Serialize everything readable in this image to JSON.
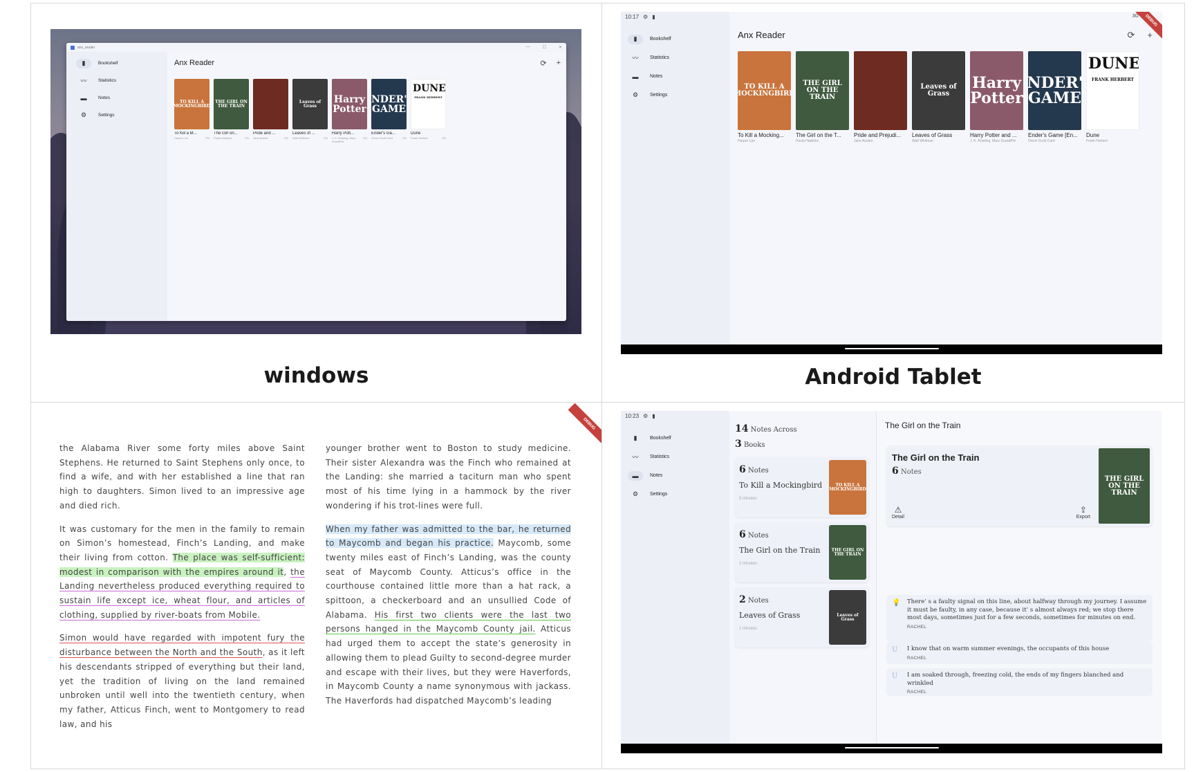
{
  "captions": {
    "windows": "windows",
    "tablet": "Android Tablet"
  },
  "app": {
    "title": "Anx Reader",
    "window_title": "anx_reader",
    "refresh_icon": "sync-icon",
    "add_icon": "plus-icon"
  },
  "nav": [
    {
      "label": "Bookshelf",
      "icon": "book-icon"
    },
    {
      "label": "Statistics",
      "icon": "chart-icon"
    },
    {
      "label": "Notes",
      "icon": "note-icon"
    },
    {
      "label": "Settings",
      "icon": "gear-icon"
    }
  ],
  "books": [
    {
      "short": "To Kill a M...",
      "tablet": "To Kill a Mocking...",
      "author": "Harper Lee",
      "progress": "0%",
      "cover_text": "TO KILL A MOCKINGBIRD",
      "color": "#c9743c"
    },
    {
      "short": "The Girl on...",
      "tablet": "The Girl on the T...",
      "author": "Paula Hawkins",
      "progress": "0%",
      "cover_text": "THE GIRL ON THE TRAIN",
      "color": "#3f5a3e"
    },
    {
      "short": "Pride and ...",
      "tablet": "Pride and Prejudi...",
      "author": "Jane Austen",
      "progress": "0%",
      "cover_text": "",
      "color": "#6e2b22"
    },
    {
      "short": "Leaves of ...",
      "tablet": "Leaves of Grass",
      "author": "Walt Whitman",
      "progress": "0%",
      "cover_text": "Leaves of Grass",
      "color": "#3b3b3b"
    },
    {
      "short": "Harry Pott...",
      "tablet": "Harry Potter and ...",
      "author": "J. K. Rowling, Mary GrandPré",
      "progress": "0%",
      "cover_text": "Harry Potter",
      "color": "#8b5a6a"
    },
    {
      "short": "Ender's Ga...",
      "tablet": "Ender's Game [En...",
      "author": "Orson Scott Card",
      "progress": "0%",
      "cover_text": "ENDER'S GAME",
      "color": "#24384e"
    },
    {
      "short": "Dune",
      "tablet": "Dune",
      "author": "Frank Herbert",
      "progress": "0%",
      "cover_text": "DUNE",
      "sub": "FRANK HERBERT",
      "color": "#ffffff"
    }
  ],
  "tablet_status": {
    "time1": "10:17",
    "time2": "10:23",
    "network": "3G",
    "debug": "DEBUG"
  },
  "reading": {
    "left": [
      {
        "segments": [
          {
            "t": "the Alabama River some forty miles above Saint Stephens. He returned to Saint Stephens only once, to find a wife, and with her established a line that ran high to daughters. Simon lived to an impressive age and died rich."
          }
        ]
      },
      {
        "segments": [
          {
            "t": "It was customary for the men in the family to remain on Simon’s homestead, Finch’s Landing, and make their living from cotton. "
          },
          {
            "t": "The place was self-sufficient: modest in comparison with the empires around it",
            "c": "hl-green"
          },
          {
            "t": ", "
          },
          {
            "t": "the Landing nevertheless produced everything required to sustain life except ice, wheat flour, and articles of clothing, supplied by river-boats from Mobile.",
            "c": "ul-pink"
          }
        ]
      },
      {
        "segments": [
          {
            "t": "Simon would have regarded with impotent fury the disturbance between the North and the South",
            "c": "ul-red"
          },
          {
            "t": ", as it left his descendants stripped of everything but their land, yet the tradition of living on the land remained unbroken until well into the twentieth century, when my father, Atticus Finch, went to Montgomery to read law, and his"
          }
        ]
      }
    ],
    "right": [
      {
        "segments": [
          {
            "t": "younger brother went to Boston to study medicine. Their sister Alexandra was the Finch who remained at the Landing: she married a taciturn man who spent most of his time lying in a hammock by the river wondering if his trot-lines were full."
          }
        ]
      },
      {
        "segments": [
          {
            "t": "When my father was admitted to the bar, he returned to Maycomb and began his practice.",
            "c": "hl-blue"
          },
          {
            "t": " Maycomb, some twenty miles east of Finch’s Landing, was the county seat of Maycomb County. Atticus’s office in the courthouse contained little more than a hat rack, a spittoon, a checkerboard and an unsullied Code of Alabama. "
          },
          {
            "t": "His first two clients were the last two persons hanged in the Maycomb County jail.",
            "c": "ul-green"
          },
          {
            "t": " Atticus had urged them to accept the state’s generosity in allowing them to plead Guilty to second-degree murder and escape with their lives, but they were Haverfords, in Maycomb County a name synonymous with jackass. The Haverfords had dispatched Maycomb’s leading"
          }
        ]
      }
    ]
  },
  "notes": {
    "summary_notes": "14",
    "summary_notes_label": "Notes Across",
    "summary_books": "3",
    "summary_books_label": "Books",
    "cards": [
      {
        "count": "6",
        "label": "Notes",
        "book": "To Kill a Mockingbird",
        "time": "5 minutes"
      },
      {
        "count": "6",
        "label": "Notes",
        "book": "The Girl on the Train",
        "time": "2 minutes"
      },
      {
        "count": "2",
        "label": "Notes",
        "book": "Leaves of Grass",
        "time": "1 minutes"
      }
    ],
    "detail": {
      "header": "The Girl on the Train",
      "title": "The Girl on the Train",
      "count": "6",
      "count_label": "Notes",
      "detail_label": "Detail",
      "export_label": "Export",
      "quotes": [
        {
          "text": "There’ s a faulty signal on this line, about halfway through my journey. I assume it must be faulty, in any case, because it’ s almost always red; we stop there most days, sometimes just for a few seconds, sometimes for minutes on end.",
          "who": "RACHEL",
          "mark": "bulb-icon"
        },
        {
          "text": "I know that on warm summer evenings, the occupants of this house",
          "who": "RACHEL",
          "mark": "underline-icon"
        },
        {
          "text": "I am soaked through, freezing cold, the ends of my fingers blanched and wrinkled",
          "who": "RACHEL",
          "mark": "underline-icon"
        }
      ]
    }
  }
}
